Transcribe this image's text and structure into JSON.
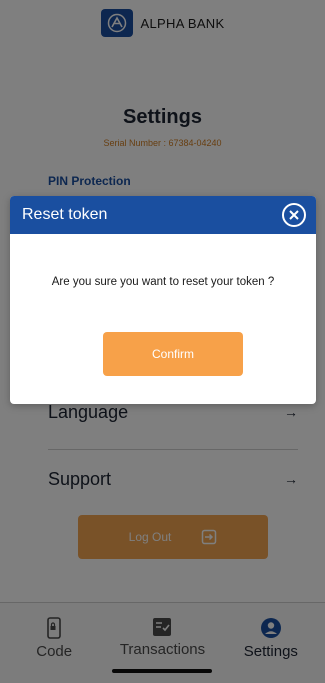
{
  "brand": {
    "name": "ALPHA BANK",
    "color": "#1a4fa0"
  },
  "page": {
    "title": "Settings",
    "serial": "Serial Number : 67384-04240",
    "pin_protection_label": "PIN Protection"
  },
  "menu": {
    "language_label": "Language",
    "support_label": "Support",
    "arrow": "→"
  },
  "logout": {
    "label": "Log Out",
    "icon": "logout-icon"
  },
  "modal": {
    "title": "Reset token",
    "message": "Are you sure you want to reset your token ?",
    "confirm_label": "Confirm",
    "accent": "#f7a149",
    "header_color": "#1a4fa0"
  },
  "tabbar": {
    "tabs": [
      {
        "label": "Code",
        "icon": "phone-lock-icon"
      },
      {
        "label": "Transactions",
        "icon": "transactions-icon"
      },
      {
        "label": "Settings",
        "icon": "user-circle-icon",
        "active": true
      }
    ]
  }
}
